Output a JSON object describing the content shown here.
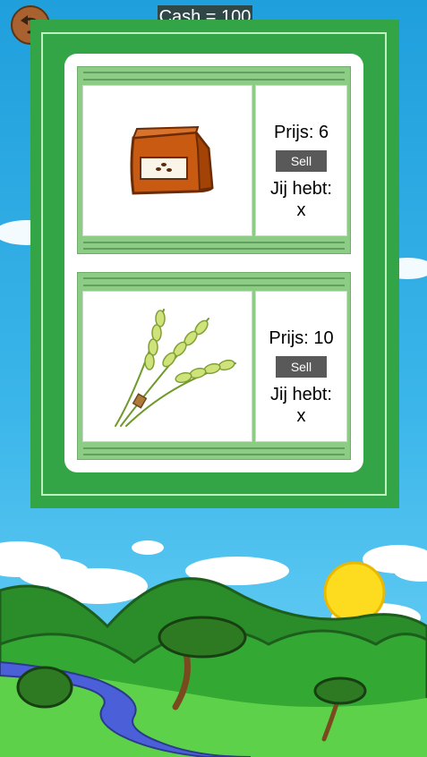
{
  "hud": {
    "cash_text": "Cash = 100",
    "back_icon": "undo-arrow-icon"
  },
  "shop": {
    "items": [
      {
        "icon": "seed-bag-icon",
        "price_text": "Prijs: 6",
        "sell_label": "Sell",
        "owned_label": "Jij hebt:",
        "owned_value": "x"
      },
      {
        "icon": "wheat-icon",
        "price_text": "Prijs: 10",
        "sell_label": "Sell",
        "owned_label": "Jij hebt:",
        "owned_value": "x"
      }
    ]
  },
  "colors": {
    "board_green": "#33a546",
    "panel_green": "#8ccc84",
    "sky_top": "#1f9fdc",
    "hill_green": "#2f9a2f",
    "sun": "#fddc20",
    "river": "#4b5fd8",
    "button_gray": "#595959"
  }
}
